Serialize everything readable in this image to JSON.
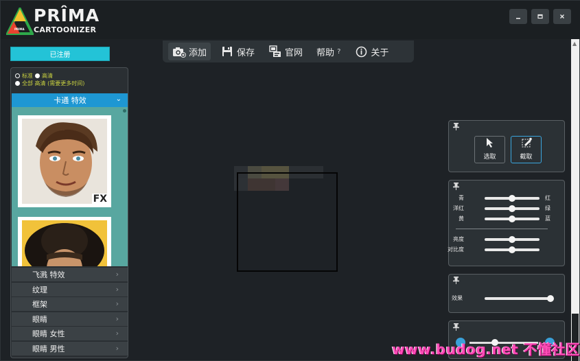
{
  "app": {
    "logo_main": "PRÎMA",
    "logo_sub": "CARTOONIZER",
    "logo_small": "PRIMA"
  },
  "window_controls": {
    "minimize": "▁",
    "maximize": "▭",
    "close": "✕"
  },
  "registered_label": "已注册",
  "toolbar": {
    "add": "添加",
    "save": "保存",
    "website": "官网",
    "help": "帮助",
    "help_q": "?",
    "about": "关于"
  },
  "quality": {
    "standard": "标准",
    "hd": "高清",
    "all_hd": "全部 高清 (需要更多时间)",
    "selected": "standard"
  },
  "effects_section": {
    "title": "卡通 特效",
    "chevron": "⌄"
  },
  "thumbnails": [
    {
      "badge": "FX"
    },
    {
      "badge": ""
    }
  ],
  "categories": [
    {
      "label": "飞溅 特效",
      "arrow": "›"
    },
    {
      "label": "纹理",
      "arrow": "›"
    },
    {
      "label": "框架",
      "arrow": "›"
    },
    {
      "label": "眼睛",
      "arrow": "›"
    },
    {
      "label": "眼睛 女性",
      "arrow": "›"
    },
    {
      "label": "眼睛 男性",
      "arrow": "›"
    }
  ],
  "select_panel": {
    "pin": "📌",
    "select": "选取",
    "crop": "截取"
  },
  "color_panel": {
    "pin": "📌",
    "rows": [
      {
        "left": "青",
        "right": "红",
        "value": 0.5
      },
      {
        "left": "洋红",
        "right": "绿",
        "value": 0.5
      },
      {
        "left": "黄",
        "right": "蓝",
        "value": 0.5
      },
      {
        "left": "亮度",
        "right": "",
        "value": 0.5
      },
      {
        "left": "对比度",
        "right": "",
        "value": 0.5
      }
    ]
  },
  "effect_panel": {
    "pin": "📌",
    "label": "效果",
    "value": 1.0
  },
  "bottom_panel": {
    "pin": "📌"
  },
  "watermark": "www.budog.net 不懂社区",
  "colors": {
    "accent_cyan": "#23c3d7",
    "section_blue": "#1e97d3",
    "thumb_bg": "#58a7a0",
    "quality_text": "#c8d040"
  }
}
